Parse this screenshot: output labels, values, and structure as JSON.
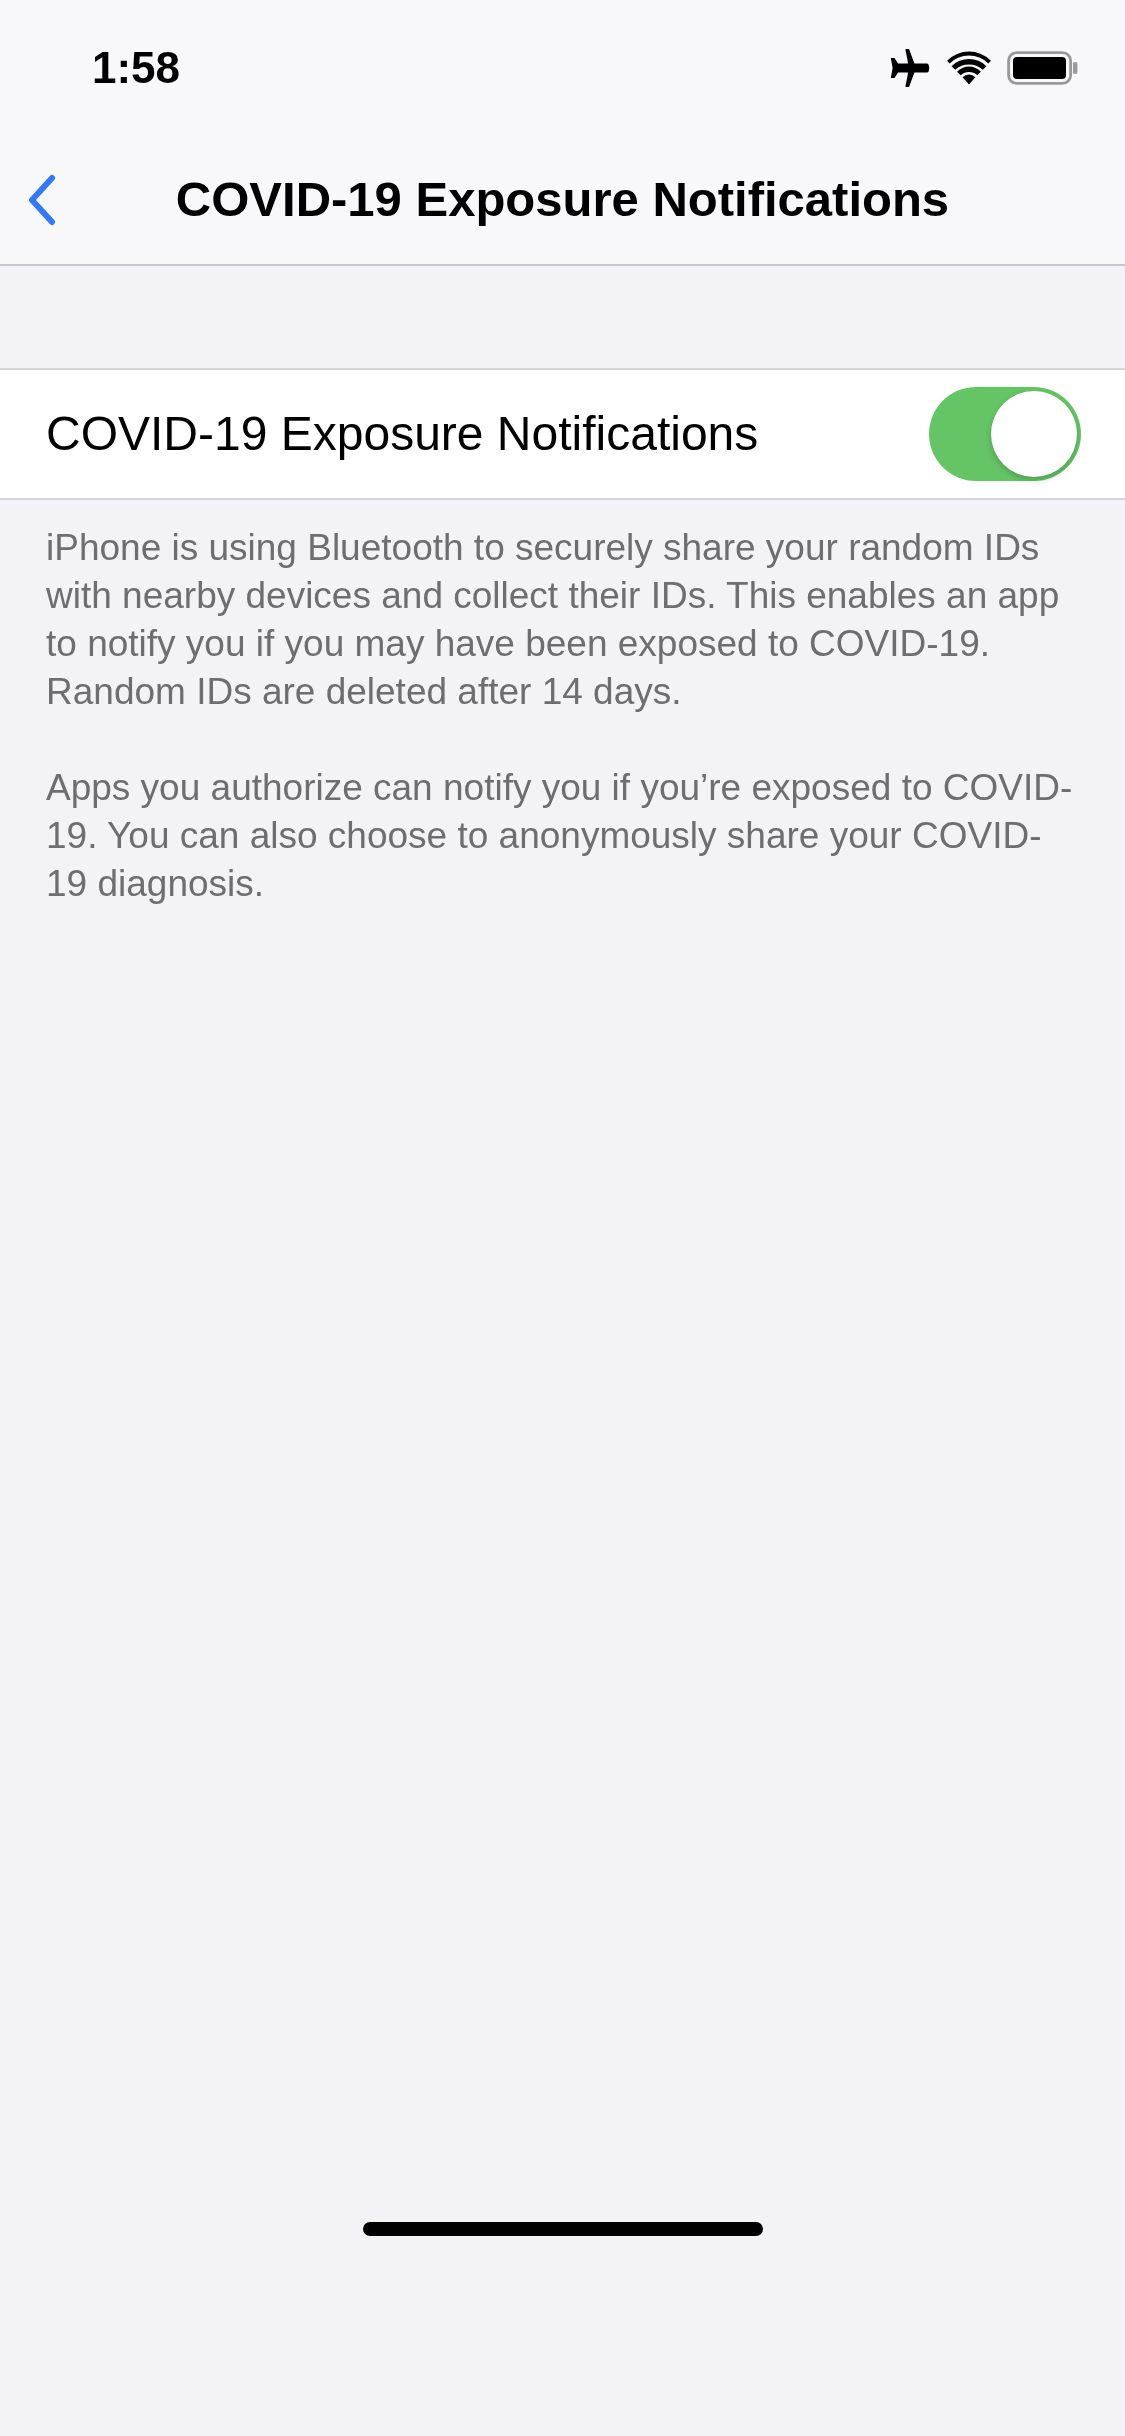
{
  "status_bar": {
    "time": "1:58"
  },
  "nav_bar": {
    "title": "COVID-19 Exposure Notifications"
  },
  "setting": {
    "label": "COVID-19 Exposure Notifications",
    "on": true
  },
  "footer": [
    "iPhone is using Bluetooth to securely share your random IDs with nearby devices and collect their IDs. This enables an app to notify you if you may have been exposed to COVID-19. Random IDs are deleted after 14 days.",
    "Apps you authorize can notify you if you’re exposed to COVID-19. You can also choose to anonymously share your COVID-19 diagnosis."
  ]
}
